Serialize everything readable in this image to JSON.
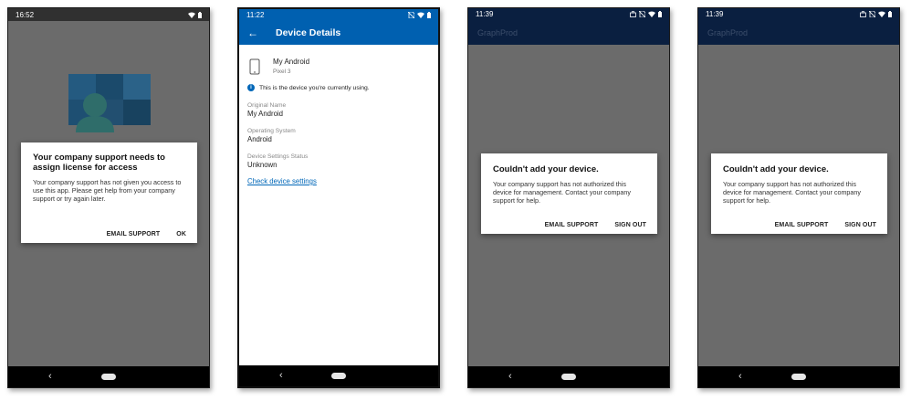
{
  "colors": {
    "accent_blue": "#0060b0",
    "dark_navy": "#0a1f40",
    "overlay_gray": "#6b6b6b",
    "link_blue": "#0067b8"
  },
  "screen1": {
    "time": "16:52",
    "dialog": {
      "title": "Your company support needs to assign license for access",
      "body": "Your company support has not given you access to use this app. Please get help from your company support or try again later.",
      "email_button": "EMAIL SUPPORT",
      "ok_button": "OK"
    }
  },
  "screen2": {
    "time": "11:22",
    "app_bar_title": "Device Details",
    "device_name": "My Android",
    "device_model": "Pixel 3",
    "info_text": "This is the device you're currently using.",
    "fields": [
      {
        "label": "Original Name",
        "value": "My Android"
      },
      {
        "label": "Operating System",
        "value": "Android"
      },
      {
        "label": "Device Settings Status",
        "value": "Unknown"
      }
    ],
    "link_text": "Check device settings"
  },
  "screen3": {
    "time": "11:39",
    "app_bar_title": "GraphProd",
    "dialog": {
      "title": "Couldn't add your device.",
      "body": "Your company support has not authorized this device for management. Contact your company support for help.",
      "email_button": "EMAIL SUPPORT",
      "signout_button": "SIGN OUT"
    }
  },
  "screen4": {
    "time": "11:39",
    "app_bar_title": "GraphProd",
    "dialog": {
      "title": "Couldn't add your device.",
      "body": "Your company support has not authorized this device for management. Contact your company support for help.",
      "email_button": "EMAIL SUPPORT",
      "signout_button": "SIGN OUT"
    }
  },
  "nav": {
    "back_glyph": "‹"
  }
}
